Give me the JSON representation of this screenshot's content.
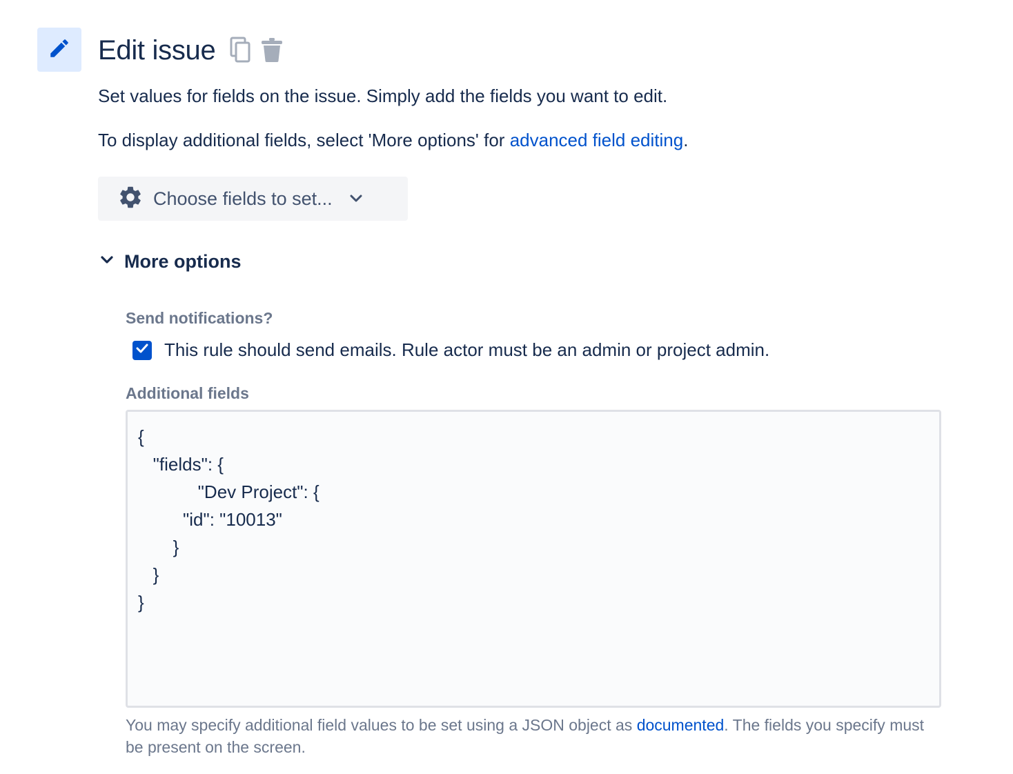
{
  "header": {
    "title": "Edit issue",
    "icon": "pencil-icon",
    "actions": [
      "copy-icon",
      "trash-icon"
    ],
    "accent_bg": "#deebff",
    "accent": "#0052cc"
  },
  "description": {
    "line1": "Set values for fields on the issue. Simply add the fields you want to edit.",
    "line2_prefix": "To display additional fields, select 'More options' for ",
    "line2_link": "advanced field editing",
    "line2_suffix": "."
  },
  "choose_fields": {
    "label": "Choose fields to set...",
    "icon": "gear-icon"
  },
  "more_options": {
    "label": "More options",
    "expanded": true
  },
  "notifications": {
    "label": "Send notifications?",
    "checkbox_label": "This rule should send emails. Rule actor must be an admin or project admin.",
    "checked": true
  },
  "additional_fields": {
    "label": "Additional fields",
    "value": "{\n   \"fields\": {\n            \"Dev Project\": {\n         \"id\": \"10013\"\n       }\n   }\n}",
    "helper_prefix": "You may specify additional field values to be set using a JSON object as ",
    "helper_link": "documented",
    "helper_suffix": ". The fields you specify must be present on the screen."
  }
}
